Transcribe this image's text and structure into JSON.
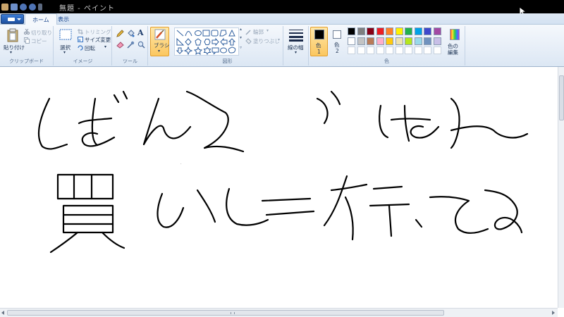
{
  "titlebar": {
    "title": "無題 - ペイント"
  },
  "tabs": [
    {
      "label": "ホーム"
    },
    {
      "label": "表示"
    }
  ],
  "clipboard": {
    "paste": "貼り付け",
    "cut": "切り取り",
    "copy": "コピー",
    "group": "クリップボード"
  },
  "image": {
    "select": "選択",
    "trim": "トリミング",
    "resize": "サイズ変更",
    "rotate": "回転",
    "group": "イメージ"
  },
  "tools": {
    "group": "ツール"
  },
  "brush": {
    "label": "ブラシ"
  },
  "shapes": {
    "outline": "輪郭",
    "fill": "塗りつぶし",
    "group": "図形"
  },
  "size": {
    "label": "線の幅"
  },
  "colors": {
    "color1_label": "色",
    "color1_num": "1",
    "color2_label": "色",
    "color2_num": "2",
    "edit_label_1": "色の",
    "edit_label_2": "編集",
    "group": "色",
    "color1": "#000000",
    "color2": "#ffffff",
    "palette_row1": [
      "#000000",
      "#7f7f7f",
      "#880015",
      "#ed1c24",
      "#ff7f27",
      "#fff200",
      "#22b14c",
      "#00a2e8",
      "#3f48cc",
      "#a349a4"
    ],
    "palette_row2": [
      "#ffffff",
      "#c3c3c3",
      "#b97a57",
      "#ffaec9",
      "#ffc90e",
      "#efe4b0",
      "#b5e61d",
      "#99d9ea",
      "#7092be",
      "#c8bfe7"
    ]
  },
  "canvas": {
    "drawing_line1": "しばんごはん",
    "drawing_line2": "買いにイテてる"
  }
}
